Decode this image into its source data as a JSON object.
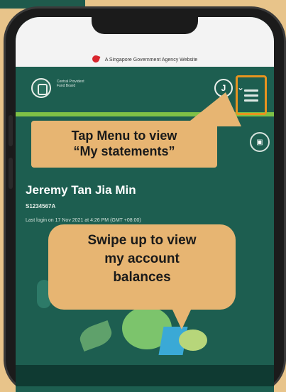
{
  "gov_banner": {
    "text": "A Singapore Government Agency Website"
  },
  "header": {
    "logo_text": "Central Provident Fund Board",
    "avatar_initial": "J",
    "dropdown_glyph": "⌄"
  },
  "profile": {
    "name": "Jeremy Tan Jia Min",
    "id": "S1234567A",
    "last_login": "Last login on 17 Nov 2021 at 4:26 PM (GMT +08:00)"
  },
  "callouts": {
    "menu_line1": "Tap Menu to view",
    "menu_line2": "“My statements”",
    "swipe_line1": "Swipe up to view",
    "swipe_line2": "my account",
    "swipe_line3": "balances"
  },
  "icons": {
    "menu": "hamburger-icon",
    "document": "document-icon",
    "avatar": "user-avatar",
    "dropdown": "chevron-down-icon"
  },
  "colors": {
    "background": "#e8c48a",
    "app_green": "#1d5e50",
    "accent_green": "#7fc146",
    "callout": "#e7b572",
    "highlight_border": "#e8941f"
  }
}
